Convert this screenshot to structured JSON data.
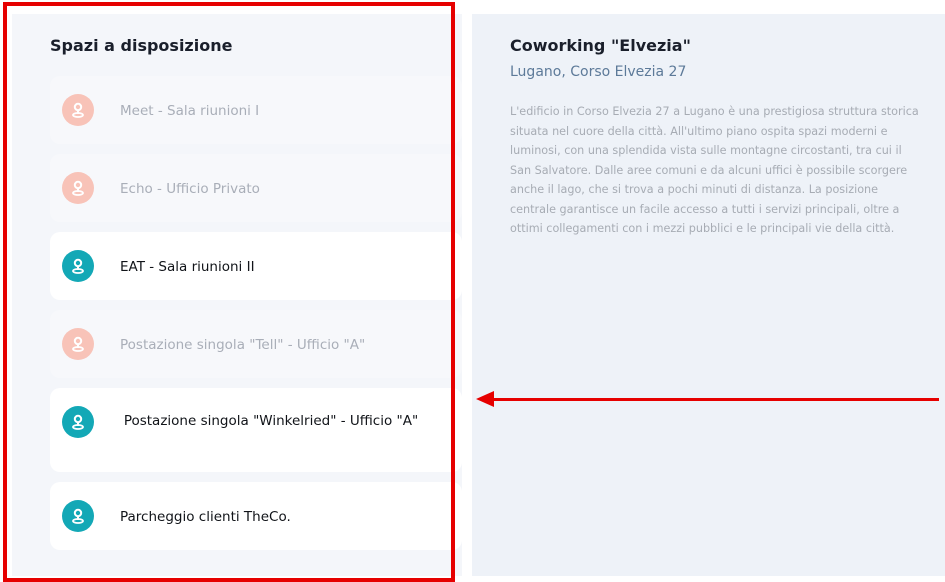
{
  "spaces": {
    "title": "Spazi a disposizione",
    "items": [
      {
        "label": "Meet - Sala riunioni I",
        "state": "inactive"
      },
      {
        "label": "Echo - Ufficio Privato",
        "state": "inactive"
      },
      {
        "label": "EAT - Sala riunioni II",
        "state": "active"
      },
      {
        "label": "Postazione singola \"Tell\" - Ufficio \"A\"",
        "state": "inactive"
      },
      {
        "label": "Postazione singola \"Winkelried\" - Ufficio \"A\"",
        "state": "active"
      },
      {
        "label": "Parcheggio clienti TheCo.",
        "state": "active"
      }
    ],
    "icon": "location-pin-icon",
    "colors": {
      "active_icon": "#13a8b6",
      "inactive_icon": "#f8c3b8"
    }
  },
  "detail": {
    "title": "Coworking \"Elvezia\"",
    "subtitle": "Lugano, Corso Elvezia 27",
    "description": "L'edificio in Corso Elvezia 27 a Lugano è una prestigiosa struttura storica situata nel cuore della città. All'ultimo piano ospita spazi moderni e luminosi, con una splendida vista sulle montagne circostanti, tra cui il San Salvatore. Dalle aree comuni e da alcuni uffici è possibile scorgere anche il lago, che si trova a pochi minuti di distanza. La posizione centrale garantisce un facile accesso a tutti i servizi principali, oltre a ottimi collegamenti con i mezzi pubblici e le principali vie della città."
  },
  "annotation": {
    "color": "#e60000"
  }
}
